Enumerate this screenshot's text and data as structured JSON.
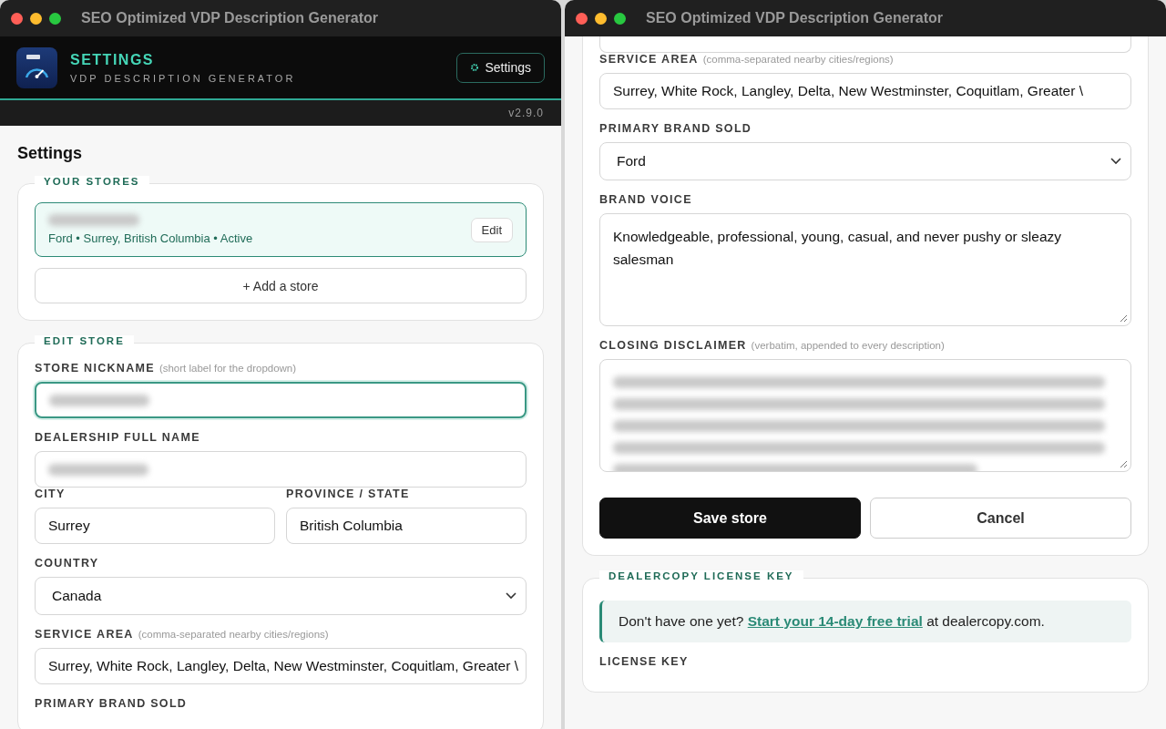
{
  "windows": [
    {
      "title": "SEO Optimized VDP Description Generator",
      "header": {
        "title": "SETTINGS",
        "subtitle": "VDP DESCRIPTION GENERATOR",
        "button": "Settings"
      },
      "version": "v2.9.0",
      "page_title": "Settings",
      "sections": [
        {
          "legend": "YOUR STORES",
          "stores": [
            {
              "name_blurred": true,
              "details": "Ford • Surrey, British Columbia • Active",
              "selected": true,
              "edit": "Edit"
            }
          ],
          "add_button": "+ Add a store"
        },
        {
          "legend": "EDIT STORE",
          "fields": [
            {
              "kind": "text",
              "label": "STORE NICKNAME",
              "hint": "(short label for the dropdown)",
              "blurred": true,
              "focused": true
            },
            {
              "kind": "text",
              "label": "DEALERSHIP FULL NAME",
              "blurred": true,
              "focused": false
            },
            {
              "kind": "pair",
              "fields": [
                {
                  "kind": "text",
                  "label": "CITY",
                  "value": "Surrey",
                  "focused": false
                },
                {
                  "kind": "text",
                  "label": "PROVINCE / STATE",
                  "value": "British Columbia",
                  "focused": false
                }
              ]
            },
            {
              "kind": "select",
              "label": "COUNTRY",
              "value": "Canada"
            },
            {
              "kind": "text",
              "label": "SERVICE AREA",
              "hint": "(comma-separated nearby cities/regions)",
              "value": "Surrey, White Rock, Langley, Delta, New Westminster, Coquitlam, Greater \\",
              "focused": false
            },
            {
              "kind": "label",
              "label": "PRIMARY BRAND SOLD"
            }
          ]
        }
      ]
    },
    {
      "title": "SEO Optimized VDP Description Generator",
      "sections": [
        {
          "cut_top": true,
          "fields": [
            {
              "kind": "stub"
            },
            {
              "kind": "text",
              "label": "SERVICE AREA",
              "hint": "(comma-separated nearby cities/regions)",
              "value": "Surrey, White Rock, Langley, Delta, New Westminster, Coquitlam, Greater \\",
              "focused": false
            },
            {
              "kind": "select",
              "label": "PRIMARY BRAND SOLD",
              "value": "Ford"
            },
            {
              "kind": "textarea",
              "label": "BRAND VOICE",
              "value": "Knowledgeable, professional, young, casual, and never pushy or sleazy salesman"
            },
            {
              "kind": "textarea",
              "label": "CLOSING DISCLAIMER",
              "hint": "(verbatim, appended to every description)",
              "blurred": true
            }
          ],
          "buttons": [
            {
              "label": "Save store",
              "kind": "primary"
            },
            {
              "label": "Cancel",
              "kind": "secondary"
            }
          ]
        },
        {
          "legend": "DEALERCOPY LICENSE KEY",
          "callout": {
            "before": "Don't have one yet?",
            "link": "Start your 14-day free trial",
            "after": "at dealercopy.com."
          },
          "fields": [
            {
              "kind": "label",
              "label": "LICENSE KEY"
            }
          ]
        }
      ]
    }
  ]
}
